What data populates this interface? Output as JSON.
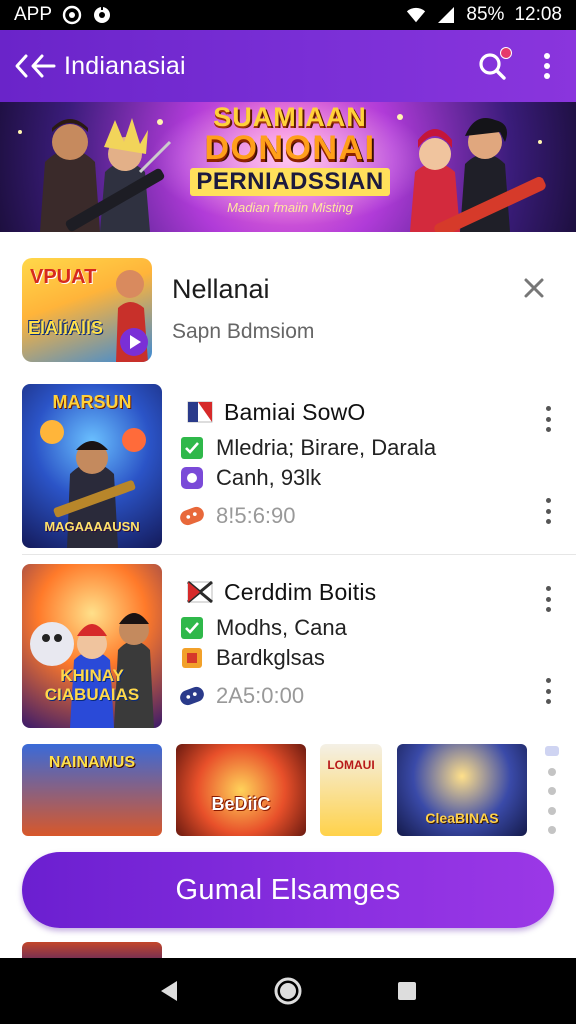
{
  "status_bar": {
    "left_text": "APP",
    "battery_text": "85%",
    "time": "12:08",
    "icons": [
      "app-circle-icon",
      "app-gear-icon",
      "wifi-icon",
      "signal-icon"
    ]
  },
  "app_bar": {
    "title": "Indianasiai",
    "back_icon": "back-arrow-icon",
    "search_icon": "search-icon",
    "menu_icon": "kebab-menu-icon",
    "accent": "#7a2fd6"
  },
  "banner": {
    "line1": "SUAMIAAN",
    "line2": "DONONAI",
    "line3": "PERNIADSSIAN",
    "line4": "Madian fmaiin Misting"
  },
  "featured": {
    "thumb_text_top": "VPUAT",
    "thumb_text_bottom": "ElAliAllS",
    "title": "Nellanai",
    "subtitle": "Sapn Bdmsiom",
    "close_icon": "close-icon"
  },
  "games": [
    {
      "thumb_title": "MARSUN",
      "thumb_bottom": "MAGAAAAUSN",
      "title": "Bamiai SowO",
      "line2": "Mledria; Birare, Darala",
      "line3": "Canh, 93lk",
      "price": "8!5:6:90"
    },
    {
      "thumb_title": "",
      "thumb_bottom": "KHINAY CIABUAIAS",
      "title": "Cerddim Boitis",
      "line2": "Modhs, Cana",
      "line3": "Bardkglsas",
      "price": "2A5:0:00"
    }
  ],
  "strip": [
    {
      "label": "NAINAMUS"
    },
    {
      "label": "BeDiiC"
    },
    {
      "label": "LOMAUI"
    },
    {
      "label": "CleaBINAS"
    }
  ],
  "cta": {
    "label": "Gumal Elsamges"
  },
  "nav": {
    "back_icon": "nav-back-icon",
    "home_icon": "nav-home-icon",
    "recents_icon": "nav-recents-icon"
  }
}
